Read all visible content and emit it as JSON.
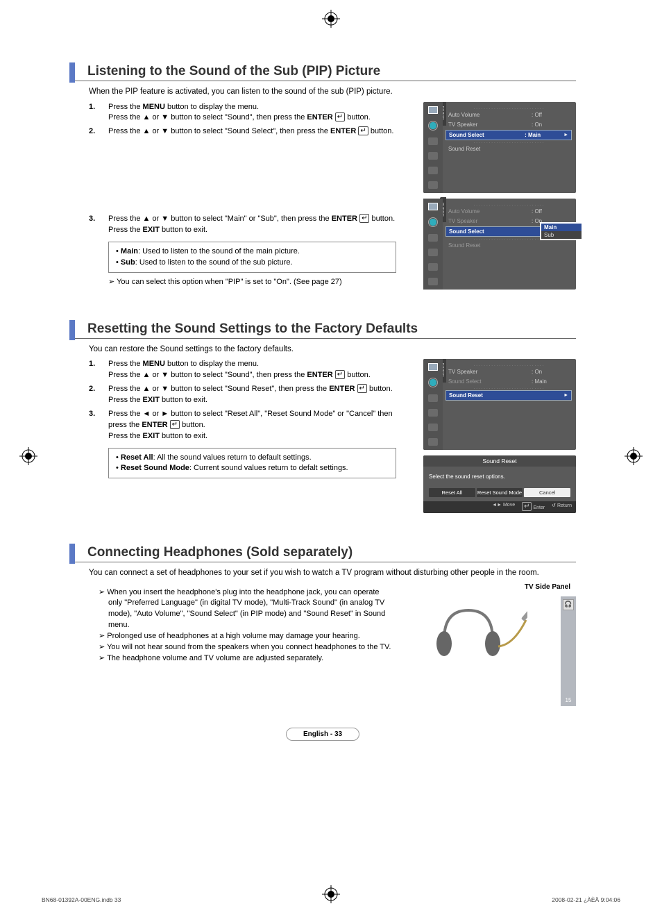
{
  "sections": {
    "pip": {
      "title": "Listening to the Sound of the Sub (PIP) Picture",
      "intro": "When the PIP feature is activated, you can listen to the sound of the sub (PIP) picture.",
      "step1a": "Press the ",
      "step1_menu": "MENU",
      "step1b": " button to display the menu.",
      "step1c": "Press the ▲ or ▼ button to select \"Sound\", then press the ",
      "step1_enter": "ENTER",
      "step1d": " button.",
      "step2a": "Press the ▲ or ▼ button to select \"Sound Select\", then press the ",
      "step2_enter": "ENTER",
      "step2b": " button.",
      "step3a": "Press the ▲ or ▼ button to select \"Main\" or \"Sub\", then press the ",
      "step3_enter": "ENTER",
      "step3b": " button.",
      "step3c": "Press the ",
      "step3_exit": "EXIT",
      "step3d": " button to exit.",
      "box_main_label": "Main",
      "box_main_desc": ": Used to listen to the sound of the main picture.",
      "box_sub_label": "Sub",
      "box_sub_desc": ": Used to listen to the sound of the sub picture.",
      "note": "You can select this option when \"PIP\" is set to \"On\". (See page 27)"
    },
    "reset": {
      "title": "Resetting the Sound Settings to the Factory Defaults",
      "intro": "You can restore the Sound settings to the factory defaults.",
      "step1a": "Press the ",
      "step1_menu": "MENU",
      "step1b": " button to display the menu.",
      "step1c": "Press the ▲ or ▼ button to select \"Sound\", then press the ",
      "step1_enter": "ENTER",
      "step1d": " button.",
      "step2a": "Press the ▲ or ▼ button to select \"Sound Reset\", then press the ",
      "step2_enter": "ENTER",
      "step2b": " button.",
      "step2c": "Press the ",
      "step2_exit": "EXIT",
      "step2d": " button to exit.",
      "step3a": "Press the ◄ or ► button to select \"Reset All\", \"Reset Sound Mode\" or \"Cancel\" then press the ",
      "step3_enter": "ENTER",
      "step3b": " button.",
      "step3c": "Press the ",
      "step3_exit": "EXIT",
      "step3d": " button to exit.",
      "box_ra_label": "Reset All",
      "box_ra_desc": ": All the sound values return to default settings.",
      "box_rsm_label": "Reset Sound Mode",
      "box_rsm_desc": ": Current sound values return to defalt settings."
    },
    "headphones": {
      "title": "Connecting Headphones (Sold separately)",
      "intro": "You can connect a set of headphones to your set if you wish to watch a TV program without disturbing other people in the room.",
      "n1": "When you insert the headphone's plug into the headphone jack, you can operate only \"Preferred Language\" (in digital TV mode), \"Multi-Track Sound\" (in analog TV mode), \"Auto Volume\", \"Sound Select\" (in PIP mode) and \"Sound Reset\" in Sound menu.",
      "n2": "Prolonged use of headphones at a high volume may damage your hearing.",
      "n3": "You will not hear sound from the speakers when you connect headphones to the TV.",
      "n4": "The headphone volume and TV volume are adjusted separately.",
      "panel_label": "TV Side Panel",
      "port_val": "15"
    }
  },
  "osd": {
    "tab_label": "Sound",
    "screen1": {
      "rows": [
        {
          "label": "Auto Volume",
          "val": ": Off"
        },
        {
          "label": "TV Speaker",
          "val": ": On"
        },
        {
          "label": "Sound Select",
          "val": ": Main",
          "sel": true,
          "arrow": "►"
        },
        {
          "label": "Sound Reset",
          "val": ""
        }
      ]
    },
    "screen2": {
      "rows": [
        {
          "label": "Auto Volume",
          "val": ": Off",
          "dim": true
        },
        {
          "label": "TV Speaker",
          "val": ": On",
          "dim": true
        },
        {
          "label": "Sound Select",
          "val": "",
          "sel": true
        },
        {
          "label": "Sound Reset",
          "val": "",
          "dim": true
        }
      ],
      "popup": {
        "opt1": "Main",
        "opt2": "Sub",
        "sel": 0
      }
    },
    "screen3": {
      "rows": [
        {
          "label": "TV Speaker",
          "val": ": On"
        },
        {
          "label": "Sound Select",
          "val": ": Main",
          "dim": true
        },
        {
          "label": "Sound Reset",
          "val": "",
          "sel": true,
          "arrow": "►"
        }
      ]
    },
    "dialog": {
      "title": "Sound Reset",
      "msg": "Select the sound reset options.",
      "btn1": "Reset All",
      "btn2": "Reset Sound Mode",
      "btn3": "Cancel",
      "f_move": "Move",
      "f_enter": "Enter",
      "f_return": "Return"
    }
  },
  "page_badge": "English - 33",
  "footer": {
    "left": "BN68-01392A-00ENG.indb   33",
    "right": "2008-02-21   ¿ÀÈÄ 9:04:06"
  }
}
